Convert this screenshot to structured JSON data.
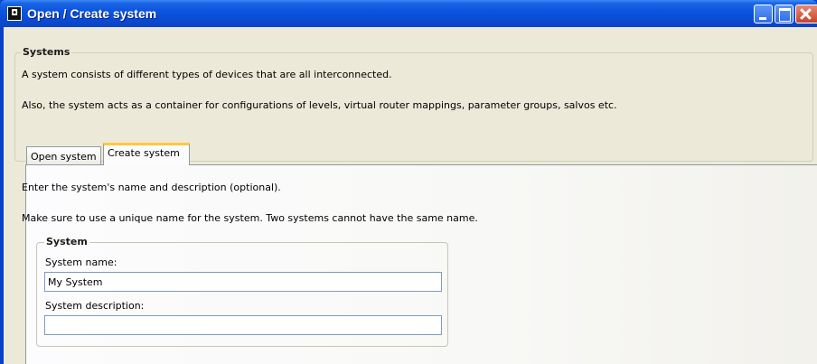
{
  "window": {
    "title": "Open / Create system",
    "app_icon": "app-icon",
    "controls": {
      "minimize": "minimize-icon",
      "maximize": "maximize-icon",
      "close": "close-icon"
    }
  },
  "systems_group": {
    "legend": "Systems",
    "line1": "A system consists of different types of devices that are all interconnected.",
    "line2": "Also, the system acts as a container for configurations of levels, virtual router mappings, parameter groups, salvos etc."
  },
  "tabs": [
    {
      "label": "Open system",
      "active": false
    },
    {
      "label": "Create system",
      "active": true
    }
  ],
  "create_panel": {
    "line1": "Enter the system's name and description (optional).",
    "line2": "Make sure to use a unique name for the system. Two systems cannot have the same name.",
    "system_group": {
      "legend": "System",
      "name_label": "System name:",
      "name_value": "My System",
      "description_label": "System description:",
      "description_value": ""
    }
  },
  "colors": {
    "titlebar": "#0A55DF",
    "window_bg": "#ECE9D8",
    "active_tab_accent": "#FFC83C",
    "input_border": "#7F9DB9"
  }
}
